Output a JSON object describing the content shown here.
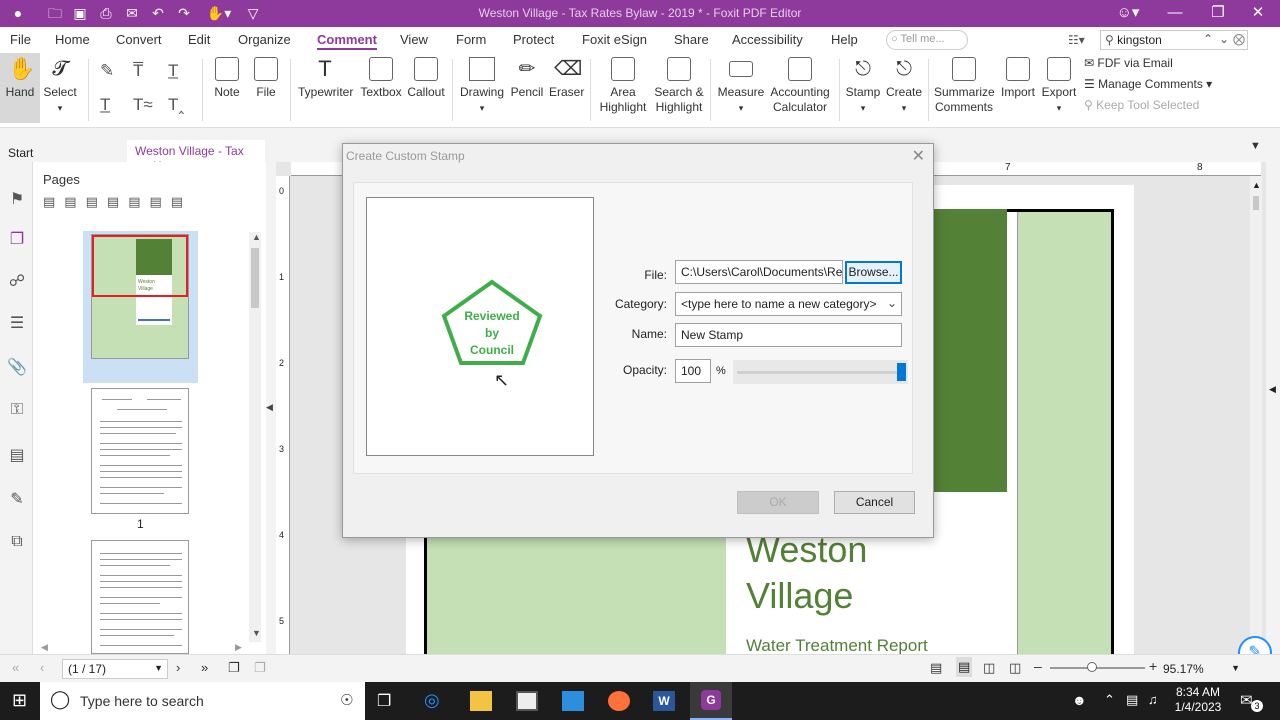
{
  "window": {
    "title": "Weston Village - Tax Rates Bylaw - 2019 * - Foxit PDF Editor"
  },
  "menu": {
    "items": [
      "File",
      "Home",
      "Convert",
      "Edit",
      "Organize",
      "Comment",
      "View",
      "Form",
      "Protect",
      "Foxit eSign",
      "Share",
      "Accessibility",
      "Help"
    ],
    "active": "Comment",
    "tell_me_placeholder": "Tell me...",
    "search_value": "kingston"
  },
  "ribbon": {
    "hand": "Hand",
    "select": "Select",
    "note": "Note",
    "file": "File",
    "typewriter": "Typewriter",
    "textbox": "Textbox",
    "callout": "Callout",
    "drawing": "Drawing",
    "pencil": "Pencil",
    "eraser": "Eraser",
    "area_highlight": [
      "Area",
      "Highlight"
    ],
    "search_highlight": [
      "Search &",
      "Highlight"
    ],
    "measure": "Measure",
    "accounting_calculator": [
      "Accounting",
      "Calculator"
    ],
    "stamp": "Stamp",
    "create": "Create",
    "summarize_comments": [
      "Summarize",
      "Comments"
    ],
    "import": "Import",
    "export": "Export",
    "fdf_via_email": "FDF via Email",
    "manage_comments": "Manage Comments",
    "keep_tool_selected": "Keep Tool Selected"
  },
  "tabs": {
    "start": "Start",
    "doc": "Weston Village  - Tax ..."
  },
  "pages_panel": {
    "header": "Pages",
    "page1_label": "1",
    "thumb_title": [
      "Weston",
      "Village"
    ]
  },
  "document": {
    "title_line1": "Weston",
    "title_line2": "Village",
    "subtitle": "Water Treatment Report",
    "ruler_marks": [
      "7",
      "8"
    ],
    "vruler_marks": [
      "0",
      "1",
      "2",
      "3",
      "4",
      "5"
    ]
  },
  "dialog": {
    "title": "Create Custom Stamp",
    "stamp_text": [
      "Reviewed",
      "by",
      "Council"
    ],
    "file_label": "File:",
    "file_value": "C:\\Users\\Carol\\Documents\\Revi",
    "browse": "Browse...",
    "category_label": "Category:",
    "category_value": "<type here to name a new category>",
    "name_label": "Name:",
    "name_value": "New Stamp",
    "opacity_label": "Opacity:",
    "opacity_value": "100",
    "opacity_unit": "%",
    "opacity_level": 1.0,
    "ok": "OK",
    "cancel": "Cancel"
  },
  "statusbar": {
    "page_indicator": "(1 / 17)",
    "zoom": "95.17%"
  },
  "taskbar": {
    "search_placeholder": "Type here to search",
    "time": "8:34 AM",
    "date": "1/4/2023",
    "notification_count": "3"
  },
  "colors": {
    "accent": "#8e3a9c",
    "stamp_green": "#3fae49",
    "doc_dark_green": "#538135",
    "doc_light_green": "#c5e0b4"
  }
}
